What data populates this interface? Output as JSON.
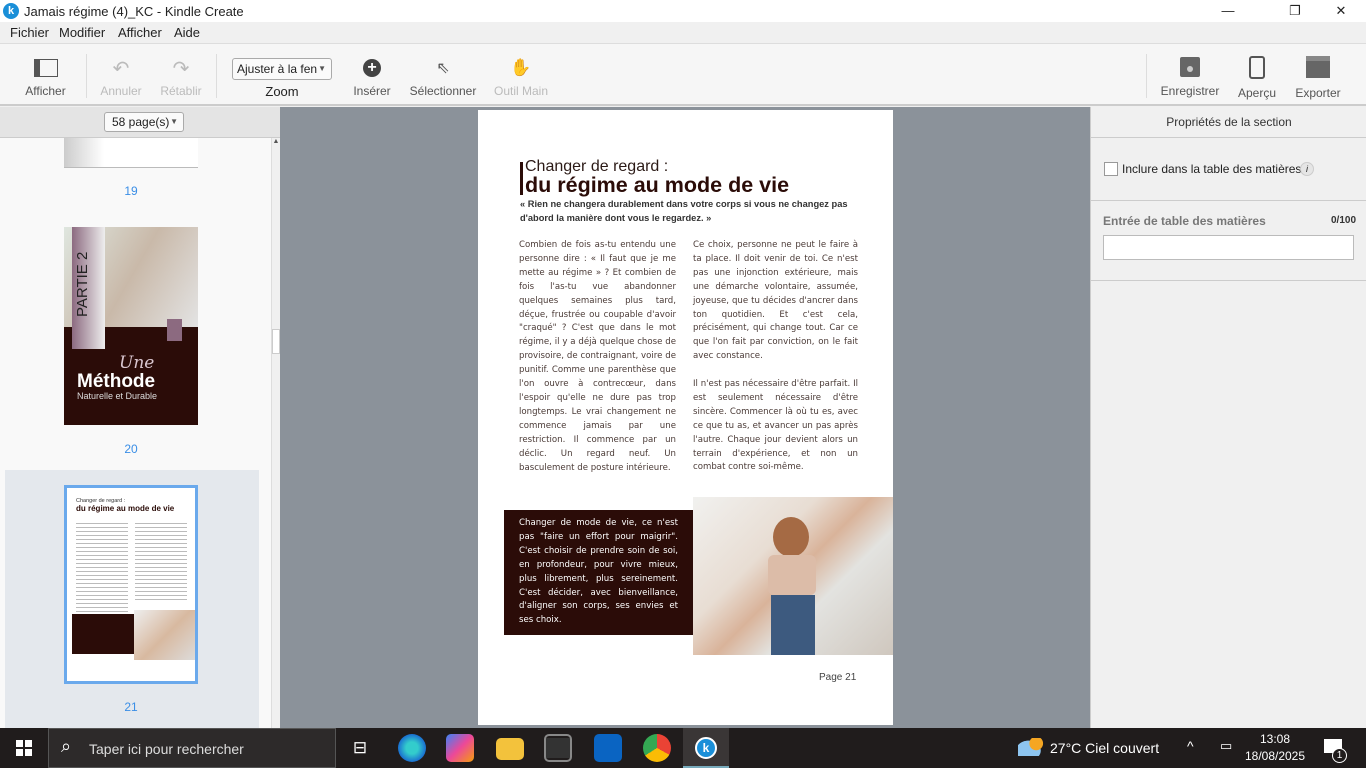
{
  "window": {
    "title": "Jamais régime (4)_KC - Kindle Create",
    "logo_letter": "k",
    "minimize": "—",
    "maximize": "❐",
    "close": "✕"
  },
  "menu": [
    "Fichier",
    "Modifier",
    "Afficher",
    "Aide"
  ],
  "toolbar": {
    "afficher": "Afficher",
    "annuler": "Annuler",
    "retablir": "Rétablir",
    "zoom_value": "Ajuster à la fen",
    "zoom_label": "Zoom",
    "inserer": "Insérer",
    "selectionner": "Sélectionner",
    "outil_main": "Outil Main",
    "enregistrer": "Enregistrer",
    "apercu": "Aperçu",
    "exporter": "Exporter"
  },
  "thumbnails": {
    "page_count": "58 page(s)",
    "pages": [
      "19",
      "20",
      "21"
    ],
    "page20": {
      "partie": "PARTIE 2",
      "script": "Une",
      "methode": "Méthode",
      "sub": "Naturelle et Durable"
    },
    "selected": "21"
  },
  "page": {
    "title_small": "Changer de regard :",
    "title_big": "du régime au mode de vie",
    "quote": "« Rien ne changera durablement dans votre corps si vous ne changez pas d'abord la manière dont vous le regardez. »",
    "col1": "Combien de fois as-tu entendu une personne dire : « Il faut que je me mette au régime » ? Et combien de fois l'as-tu vue abandonner quelques semaines plus tard, déçue, frustrée ou coupable d'avoir \"craqué\" ? C'est que dans le mot régime, il y a déjà quelque chose de provisoire, de contraignant, voire de punitif. Comme une parenthèse que l'on ouvre à contrecœur, dans l'espoir qu'elle ne dure pas trop longtemps. Le vrai changement ne commence jamais par une restriction. Il commence par un déclic. Un regard neuf. Un basculement de posture intérieure.",
    "col2a": "Ce choix, personne ne peut le faire à ta place. Il doit venir de toi. Ce n'est pas une injonction extérieure, mais une démarche volontaire, assumée, joyeuse, que tu décides d'ancrer dans ton quotidien. Et c'est cela, précisément, qui change tout. Car ce que l'on fait par conviction, on le fait avec constance.",
    "col2b": "Il n'est pas nécessaire d'être parfait. Il est seulement nécessaire d'être sincère. Commencer là où tu es, avec ce que tu as, et avancer un pas après l'autre. Chaque jour devient alors un terrain d'expérience, et non un combat contre soi-même.",
    "box": "Changer de mode de vie, ce n'est pas \"faire un effort pour maigrir\". C'est choisir de prendre soin de soi, en profondeur, pour vivre mieux, plus librement, plus sereinement. C'est décider, avec bienveillance, d'aligner son corps, ses envies et ses choix.",
    "footer": "Page 21"
  },
  "panel": {
    "header": "Propriétés de la section",
    "checkbox_label": "Inclure dans la table des matières",
    "checked": false,
    "info": "i",
    "toc_label": "Entrée de table des matières",
    "toc_count": "0/100",
    "toc_value": ""
  },
  "taskbar": {
    "search_placeholder": "Taper ici pour rechercher",
    "weather": "27°C  Ciel couvert",
    "time": "13:08",
    "date": "18/08/2025",
    "notifications": "1"
  },
  "colors": {
    "accent": "#3a8ee6",
    "brand_dark": "#2b0c08",
    "canvas": "#8b929a"
  }
}
